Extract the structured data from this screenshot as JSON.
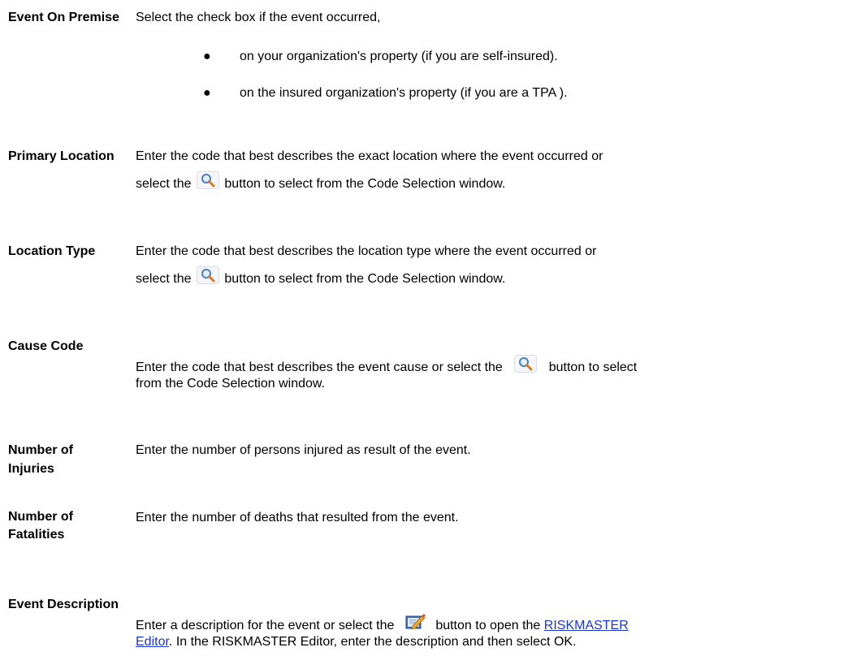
{
  "colors": {
    "text": "#000000",
    "link": "#1a35c9",
    "magnifier_frame": "#4a7fc0",
    "magnifier_handle": "#d07a2a"
  },
  "fields": {
    "event_on_premise": {
      "term": "Event On Premise",
      "intro": "Select the check box if the event occurred,",
      "bullets": [
        "on your organization's property (if you are self-insured).",
        "on the insured organization's property (if you are a TPA )."
      ]
    },
    "primary_location": {
      "term": "Primary Location",
      "line1": "Enter the code that best describes the exact location where the event occurred or",
      "before_icon": "select the",
      "after_icon": "button to select from the Code Selection window.",
      "icon": "magnifier-icon"
    },
    "location_type": {
      "term": "Location Type",
      "line1": "Enter the code that best describes the location type where the event occurred or",
      "before_icon": "select the",
      "after_icon": "button to select from the Code Selection window.",
      "icon": "magnifier-icon"
    },
    "cause_code": {
      "term": "Cause Code",
      "before_icon": "Enter the code that best describes the event cause or select the",
      "after_icon": "button to select",
      "line2": "from the Code Selection window.",
      "icon": "magnifier-icon"
    },
    "number_of_injuries": {
      "term": "Number of Injuries",
      "text": "Enter the number of persons injured as result of the event."
    },
    "number_of_fatalities": {
      "term_line1": "Number of",
      "term_line2": "Fatalities",
      "text": "Enter the number of deaths that resulted from the event."
    },
    "event_description": {
      "term": "Event Description",
      "before_icon": "Enter a description for the event or select the",
      "after_icon": "button to open the",
      "link_part1": "RISKMASTER",
      "link_part2": "Editor",
      "line2_rest": ". In the RISKMASTER Editor, enter the description and then select OK.",
      "icon": "edit-pencil-icon"
    }
  }
}
